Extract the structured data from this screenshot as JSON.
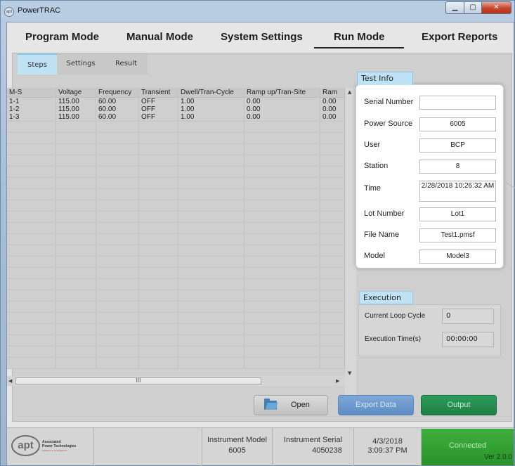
{
  "window": {
    "title": "PowerTRAC",
    "app_icon_text": "apt",
    "minimize": "▁",
    "maximize": "▢",
    "close": "✕"
  },
  "menu": {
    "items": [
      "Program Mode",
      "Manual Mode",
      "System Settings",
      "Run Mode",
      "Export Reports"
    ],
    "active": "Run Mode"
  },
  "tabs": {
    "items": [
      "Steps",
      "Settings",
      "Result"
    ],
    "active": "Steps"
  },
  "grid": {
    "columns": [
      "M-S",
      "Voltage",
      "Frequency",
      "Transient",
      "Dwell/Tran-Cycle",
      "Ramp up/Tran-Site",
      "Ram"
    ],
    "rows": [
      [
        "1-1",
        "115.00",
        "60.00",
        "OFF",
        "1.00",
        "0.00",
        "0.00"
      ],
      [
        "1-2",
        "115.00",
        "60.00",
        "OFF",
        "1.00",
        "0.00",
        "0.00"
      ],
      [
        "1-3",
        "115.00",
        "60.00",
        "OFF",
        "1.00",
        "0.00",
        "0.00"
      ]
    ],
    "scroll_up": "▲",
    "scroll_down": "▼",
    "scroll_left": "◀",
    "scroll_right": "▶",
    "hthumb_grip": "III"
  },
  "test_info": {
    "title": "Test Info",
    "fields": [
      {
        "label": "Serial Number",
        "value": ""
      },
      {
        "label": "Power Source",
        "value": "6005"
      },
      {
        "label": "User",
        "value": "BCP"
      },
      {
        "label": "Station",
        "value": "8"
      },
      {
        "label": "Time",
        "value": "2/28/2018 10:26:32 AM"
      },
      {
        "label": "Lot Number",
        "value": "Lot1"
      },
      {
        "label": "File Name",
        "value": "Test1.pmsf"
      },
      {
        "label": "Model",
        "value": "Model3"
      }
    ]
  },
  "execution": {
    "title": "Execution",
    "fields": [
      {
        "label": "Current Loop Cycle",
        "value": "0"
      },
      {
        "label": "Execution Time(s)",
        "value": "00:00:00"
      }
    ]
  },
  "buttons": {
    "open": "Open",
    "export": "Export Data",
    "output": "Output"
  },
  "status": {
    "logo_mark": "apt",
    "logo_line1": "Associated",
    "logo_line2": "Power Technologies",
    "logo_line3": "A division of ▲ Ametek Inc.",
    "instrument_model_label": "Instrument Model",
    "instrument_model": "6005",
    "instrument_serial_label": "Instrument Serial",
    "instrument_serial": "4050238",
    "date": "4/3/2018",
    "time": "3:09:37 PM",
    "connection": "Connected",
    "version": "Ver 2.0.0"
  },
  "colors": {
    "tab_active": "#bfe3f5",
    "export_button": "#6b97cd",
    "output_button": "#23874d",
    "connected": "#34a434"
  }
}
